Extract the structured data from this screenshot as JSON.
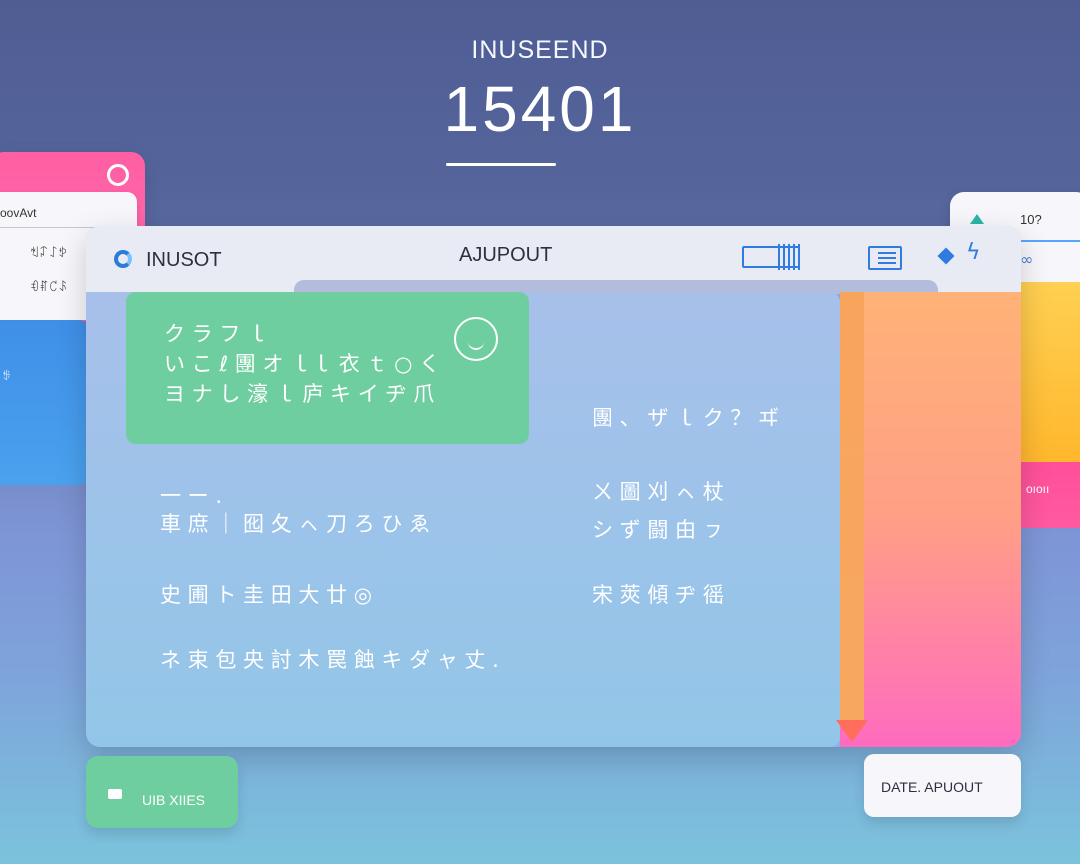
{
  "header": {
    "eyebrow": "INUSEEND",
    "big_number": "15401"
  },
  "left_panel": {
    "top_label": "oovAvt",
    "row1": "ꈐꈑ꒔ꉣ",
    "row2": "ꊙꐥ꒝ꌺ",
    "blue_label": "ꌣ"
  },
  "right_panel": {
    "label": "10?",
    "pink_label": "oıoıı"
  },
  "window": {
    "brand": "INUSOT",
    "title": "AJUPOUT"
  },
  "content": {
    "green_lines": [
      "ク ラ フ ｌ",
      "い こ ℓ 團 オ ｌｌ 衣 ｔ ○ く",
      "ヨ ナ し 濠 ｌ 庐 キ イ ヂ 爪"
    ],
    "left_lines": [
      "一 ー .",
      "車 庶 ｜ 囮 夂 ㇸ 刀 ろ ひ ゑ",
      "史 圃 ト 圭 田 大 廿 ◎",
      "ネ 束 包 央 討 木 罠 蝕 キ ダ ャ 丈 ."
    ],
    "right_lines": [
      "團 、 ザ ｌ ク ？ ヸ",
      "ㄨ 圖 刈 ㇸ 杖",
      "シ ず 闘 甶 ㇷ",
      "宋 莢 傾 ヂ 徭"
    ]
  },
  "bottom": {
    "left_label": "UIB XIIES",
    "right_label": "DATE. APUOUT"
  },
  "colors": {
    "background_top": "#4f5d93",
    "background_bottom": "#7bc3dc",
    "green": "#6fce9f",
    "pink": "#ff5fa3",
    "yellow": "#ffd052",
    "accent_blue": "#2f7be0"
  },
  "icons": [
    "ring-icon",
    "triangle-icon",
    "swirl-icon",
    "logo-icon",
    "grid-icon",
    "list-icon",
    "diamond-icon",
    "bolt-icon",
    "smile-icon",
    "puzzle-icon"
  ]
}
